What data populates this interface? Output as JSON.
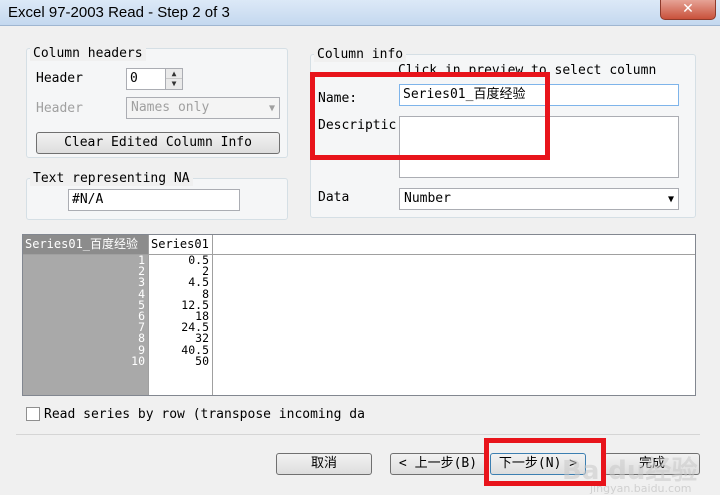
{
  "window": {
    "title": "Excel 97-2003 Read - Step 2 of 3",
    "close_glyph": "✕"
  },
  "column_headers": {
    "legend": "Column headers",
    "header_label": "Header",
    "header_value": "0",
    "header2_label": "Header",
    "header2_value": "Names only",
    "clear_button": "Clear Edited Column Info"
  },
  "na": {
    "legend": "Text representing NA",
    "value": "#N/A"
  },
  "column_info": {
    "legend": "Column info",
    "hint": "Click in preview to select column",
    "name_label": "Name:",
    "name_value": "Series01_百度经验",
    "description_label": "Descriptic",
    "description_value": "",
    "data_label": "Data",
    "data_value": "Number"
  },
  "preview": {
    "columns": [
      "Series01_百度经验",
      "Series01"
    ],
    "index": [
      "1",
      "2",
      "3",
      "4",
      "5",
      "6",
      "7",
      "8",
      "9",
      "10"
    ],
    "values": [
      "0.5",
      "2",
      "4.5",
      "8",
      "12.5",
      "18",
      "24.5",
      "32",
      "40.5",
      "50"
    ]
  },
  "options": {
    "transpose_label": "Read series by row (transpose incoming da",
    "transpose_checked": false
  },
  "buttons": {
    "cancel": "取消",
    "back": "< 上一步(B)",
    "next": "下一步(N) >",
    "finish": "完成"
  },
  "watermark": {
    "text": "Baidu经验",
    "sub": "jingyan.baidu.com"
  },
  "colors": {
    "highlight_box": "#e8141b",
    "selected_column": "#8c8c8c"
  }
}
